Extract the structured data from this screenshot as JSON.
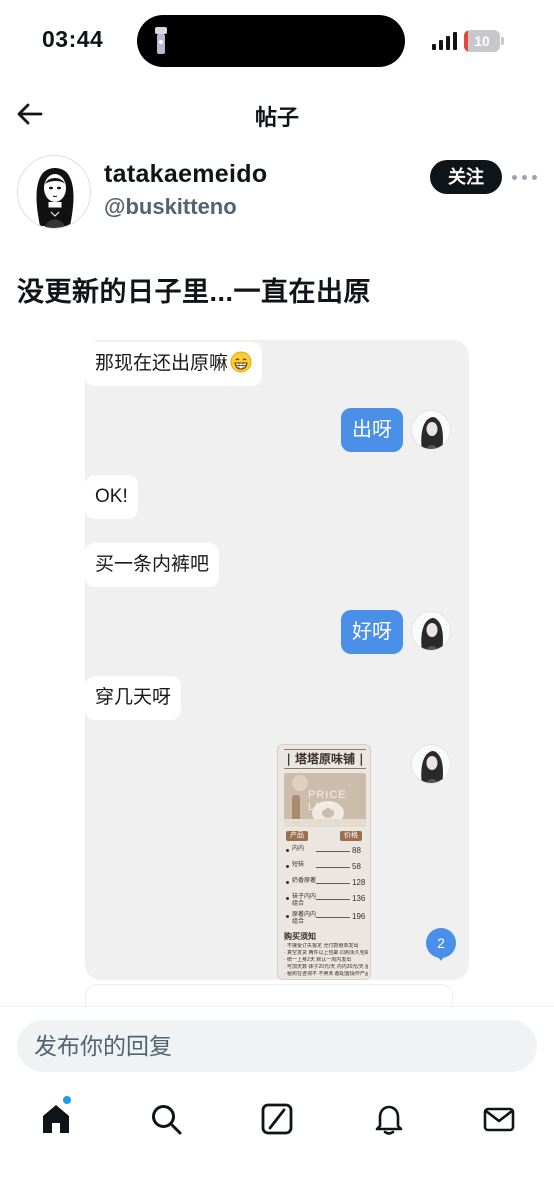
{
  "status_bar": {
    "time": "03:44",
    "battery_level": "10",
    "battery_fraction": 0.1,
    "icons": [
      "flashlight-icon",
      "signal-icon",
      "battery-icon"
    ]
  },
  "header": {
    "title": "帖子",
    "back_icon": "arrow-left-icon"
  },
  "author": {
    "display_name": "tatakaemeido",
    "handle": "@buskitteno",
    "follow_label": "关注",
    "more_icon": "more-horizontal-icon"
  },
  "post": {
    "text": "没更新的日子里...一直在出原"
  },
  "chat": {
    "messages": [
      {
        "side": "left",
        "text": "那现在还出原嘛",
        "emoji": "grinning-face-icon"
      },
      {
        "side": "right",
        "text": "出呀"
      },
      {
        "side": "left",
        "text": "OK!"
      },
      {
        "side": "left",
        "text": "买一条内裤吧"
      },
      {
        "side": "right",
        "text": "好呀"
      },
      {
        "side": "left",
        "text": "穿几天呀"
      }
    ],
    "price_card": {
      "title": "| 塔塔原味铺 |",
      "photo_text": "PRICE LIST",
      "col_product": "产品",
      "col_price": "价格",
      "items": [
        {
          "name": "内内",
          "price": "88"
        },
        {
          "name": "短袜",
          "price": "58"
        },
        {
          "name": "奶香原著",
          "price": "128"
        },
        {
          "name": "袜子内内组合",
          "price": "136"
        },
        {
          "name": "原著内内组合",
          "price": "196"
        }
      ],
      "notice_title": "购买须知",
      "notice_lines": [
        "· 不接受订失报定 允付款继单发出",
        "· 真空发货 两件以上包邮 同购永久包邮",
        "· 统一上身2天 默认一周内发出",
        "· 可加天数 袜子20元/天 内内30元/天 屋迁+40",
        "· 秘购在咨询不 不卖未 都配置操作产品安东"
      ]
    },
    "badge_count": "2"
  },
  "reply": {
    "placeholder": "发布你的回复"
  },
  "tabs": [
    {
      "name": "home",
      "icon": "home-icon"
    },
    {
      "name": "search",
      "icon": "search-icon"
    },
    {
      "name": "grok",
      "icon": "grok-icon"
    },
    {
      "name": "notifications",
      "icon": "bell-icon"
    },
    {
      "name": "messages",
      "icon": "mail-icon"
    }
  ],
  "colors": {
    "accent_blue": "#4a90e9",
    "text": "#0f1419",
    "muted": "#536471",
    "twitter_blue": "#1d9bf0"
  }
}
